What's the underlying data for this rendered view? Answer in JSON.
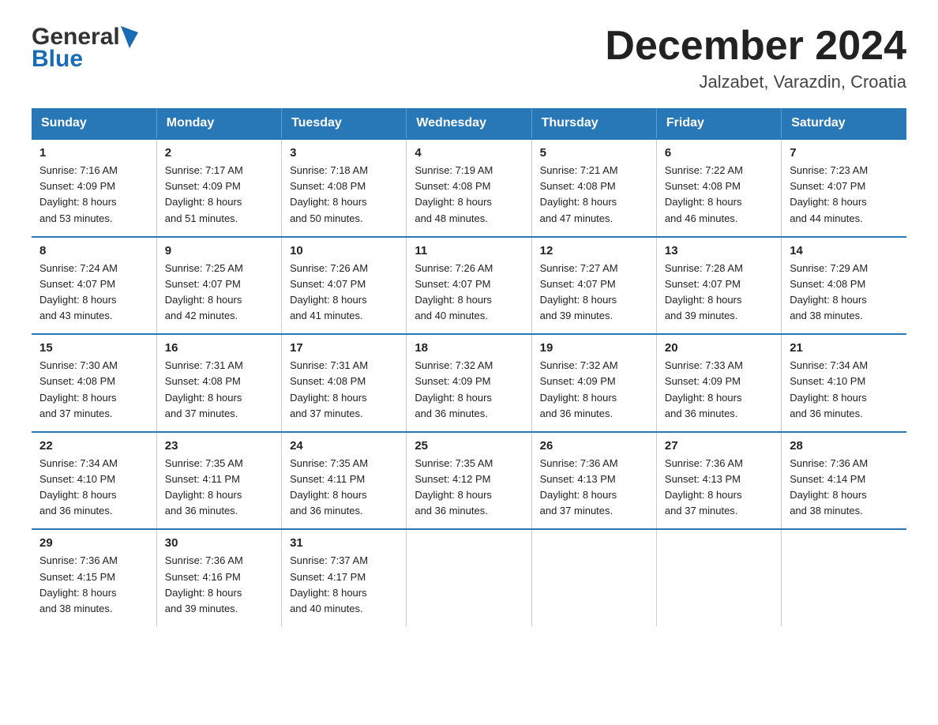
{
  "header": {
    "logo_general": "General",
    "logo_blue": "Blue",
    "main_title": "December 2024",
    "subtitle": "Jalzabet, Varazdin, Croatia"
  },
  "calendar": {
    "columns": [
      "Sunday",
      "Monday",
      "Tuesday",
      "Wednesday",
      "Thursday",
      "Friday",
      "Saturday"
    ],
    "weeks": [
      [
        {
          "day": "1",
          "sunrise": "7:16 AM",
          "sunset": "4:09 PM",
          "daylight": "8 hours and 53 minutes."
        },
        {
          "day": "2",
          "sunrise": "7:17 AM",
          "sunset": "4:09 PM",
          "daylight": "8 hours and 51 minutes."
        },
        {
          "day": "3",
          "sunrise": "7:18 AM",
          "sunset": "4:08 PM",
          "daylight": "8 hours and 50 minutes."
        },
        {
          "day": "4",
          "sunrise": "7:19 AM",
          "sunset": "4:08 PM",
          "daylight": "8 hours and 48 minutes."
        },
        {
          "day": "5",
          "sunrise": "7:21 AM",
          "sunset": "4:08 PM",
          "daylight": "8 hours and 47 minutes."
        },
        {
          "day": "6",
          "sunrise": "7:22 AM",
          "sunset": "4:08 PM",
          "daylight": "8 hours and 46 minutes."
        },
        {
          "day": "7",
          "sunrise": "7:23 AM",
          "sunset": "4:07 PM",
          "daylight": "8 hours and 44 minutes."
        }
      ],
      [
        {
          "day": "8",
          "sunrise": "7:24 AM",
          "sunset": "4:07 PM",
          "daylight": "8 hours and 43 minutes."
        },
        {
          "day": "9",
          "sunrise": "7:25 AM",
          "sunset": "4:07 PM",
          "daylight": "8 hours and 42 minutes."
        },
        {
          "day": "10",
          "sunrise": "7:26 AM",
          "sunset": "4:07 PM",
          "daylight": "8 hours and 41 minutes."
        },
        {
          "day": "11",
          "sunrise": "7:26 AM",
          "sunset": "4:07 PM",
          "daylight": "8 hours and 40 minutes."
        },
        {
          "day": "12",
          "sunrise": "7:27 AM",
          "sunset": "4:07 PM",
          "daylight": "8 hours and 39 minutes."
        },
        {
          "day": "13",
          "sunrise": "7:28 AM",
          "sunset": "4:07 PM",
          "daylight": "8 hours and 39 minutes."
        },
        {
          "day": "14",
          "sunrise": "7:29 AM",
          "sunset": "4:08 PM",
          "daylight": "8 hours and 38 minutes."
        }
      ],
      [
        {
          "day": "15",
          "sunrise": "7:30 AM",
          "sunset": "4:08 PM",
          "daylight": "8 hours and 37 minutes."
        },
        {
          "day": "16",
          "sunrise": "7:31 AM",
          "sunset": "4:08 PM",
          "daylight": "8 hours and 37 minutes."
        },
        {
          "day": "17",
          "sunrise": "7:31 AM",
          "sunset": "4:08 PM",
          "daylight": "8 hours and 37 minutes."
        },
        {
          "day": "18",
          "sunrise": "7:32 AM",
          "sunset": "4:09 PM",
          "daylight": "8 hours and 36 minutes."
        },
        {
          "day": "19",
          "sunrise": "7:32 AM",
          "sunset": "4:09 PM",
          "daylight": "8 hours and 36 minutes."
        },
        {
          "day": "20",
          "sunrise": "7:33 AM",
          "sunset": "4:09 PM",
          "daylight": "8 hours and 36 minutes."
        },
        {
          "day": "21",
          "sunrise": "7:34 AM",
          "sunset": "4:10 PM",
          "daylight": "8 hours and 36 minutes."
        }
      ],
      [
        {
          "day": "22",
          "sunrise": "7:34 AM",
          "sunset": "4:10 PM",
          "daylight": "8 hours and 36 minutes."
        },
        {
          "day": "23",
          "sunrise": "7:35 AM",
          "sunset": "4:11 PM",
          "daylight": "8 hours and 36 minutes."
        },
        {
          "day": "24",
          "sunrise": "7:35 AM",
          "sunset": "4:11 PM",
          "daylight": "8 hours and 36 minutes."
        },
        {
          "day": "25",
          "sunrise": "7:35 AM",
          "sunset": "4:12 PM",
          "daylight": "8 hours and 36 minutes."
        },
        {
          "day": "26",
          "sunrise": "7:36 AM",
          "sunset": "4:13 PM",
          "daylight": "8 hours and 37 minutes."
        },
        {
          "day": "27",
          "sunrise": "7:36 AM",
          "sunset": "4:13 PM",
          "daylight": "8 hours and 37 minutes."
        },
        {
          "day": "28",
          "sunrise": "7:36 AM",
          "sunset": "4:14 PM",
          "daylight": "8 hours and 38 minutes."
        }
      ],
      [
        {
          "day": "29",
          "sunrise": "7:36 AM",
          "sunset": "4:15 PM",
          "daylight": "8 hours and 38 minutes."
        },
        {
          "day": "30",
          "sunrise": "7:36 AM",
          "sunset": "4:16 PM",
          "daylight": "8 hours and 39 minutes."
        },
        {
          "day": "31",
          "sunrise": "7:37 AM",
          "sunset": "4:17 PM",
          "daylight": "8 hours and 40 minutes."
        },
        null,
        null,
        null,
        null
      ]
    ]
  }
}
